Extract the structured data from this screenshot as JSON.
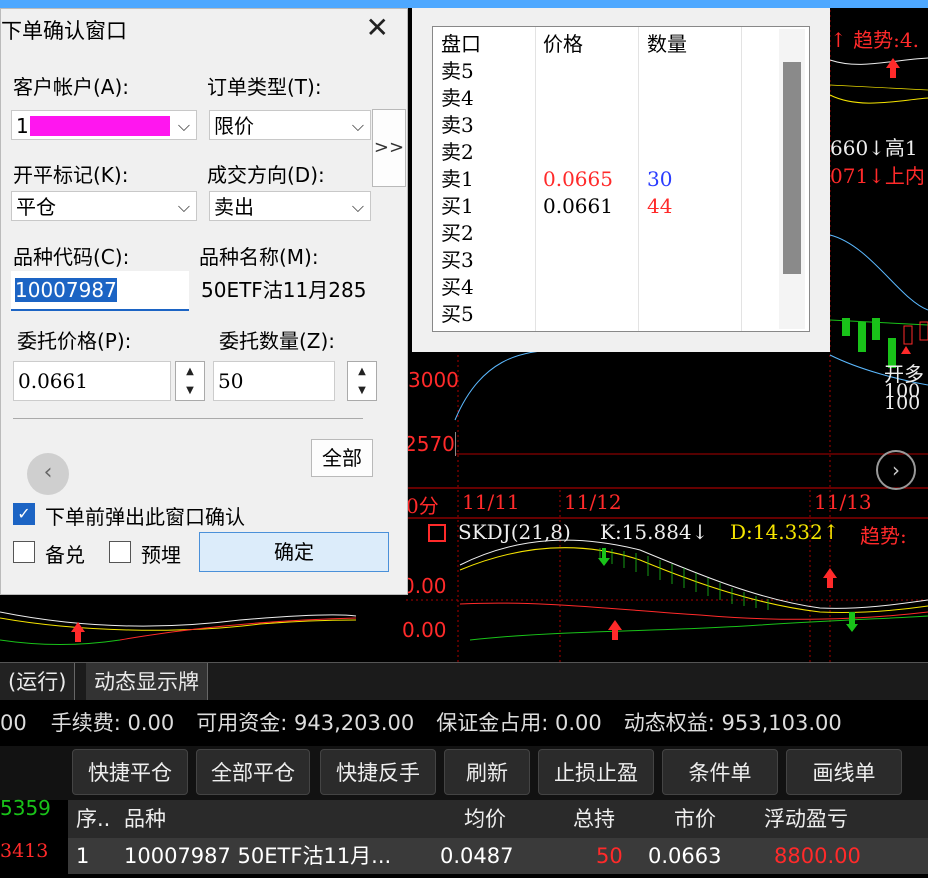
{
  "dialog": {
    "title": "下单确认窗口",
    "close": "✕",
    "account_label": "客户帐户(A):",
    "account_value": "1",
    "order_type_label": "订单类型(T):",
    "order_type_value": "限价",
    "open_close_label": "开平标记(K):",
    "open_close_value": "平仓",
    "direction_label": "成交方向(D):",
    "direction_value": "卖出",
    "code_label": "品种代码(C):",
    "code_value": "10007987",
    "name_label": "品种名称(M):",
    "name_value": "50ETF沽11月285",
    "price_label": "委托价格(P):",
    "price_value": "0.0661",
    "qty_label": "委托数量(Z):",
    "qty_value": "50",
    "all_button": "全部",
    "expand_button": ">>",
    "confirm_popup_label": "下单前弹出此窗口确认",
    "covered_label": "备兑",
    "preset_label": "预埋",
    "confirm_button": "确定"
  },
  "order_book": {
    "headers": [
      "盘口",
      "价格",
      "数量"
    ],
    "rows": [
      {
        "side": "卖5",
        "price": "",
        "qty": ""
      },
      {
        "side": "卖4",
        "price": "",
        "qty": ""
      },
      {
        "side": "卖3",
        "price": "",
        "qty": ""
      },
      {
        "side": "卖2",
        "price": "",
        "qty": ""
      },
      {
        "side": "卖1",
        "price": "0.0665",
        "qty": "30"
      },
      {
        "side": "买1",
        "price": "0.0661",
        "qty": "44"
      },
      {
        "side": "买2",
        "price": "",
        "qty": ""
      },
      {
        "side": "买3",
        "price": "",
        "qty": ""
      },
      {
        "side": "买4",
        "price": "",
        "qty": ""
      },
      {
        "side": "买5",
        "price": "",
        "qty": ""
      }
    ]
  },
  "chart": {
    "trend_top": "↑ 趋势:4.",
    "val_660": "660↓高1",
    "val_071": "071↓上内",
    "y_3000": "3000",
    "y_2570": "2570",
    "min_label": "0分",
    "dates": [
      "11/11",
      "11/12",
      "11/13"
    ],
    "indicator": "SKDJ(21,8)",
    "k_value": "K:15.884↓",
    "d_value": "D:14.332↑",
    "trend_bottom": "趋势:",
    "y_000a": "0.00",
    "y_000b": "0.00",
    "annot_1": "开多",
    "annot_2": "100",
    "annot_3": "100"
  },
  "tabs": [
    "(运行)",
    "动态显示牌"
  ],
  "status": {
    "lead": "00",
    "fee": "手续费: 0.00",
    "available": "可用资金: 943,203.00",
    "margin": "保证金占用: 0.00",
    "equity": "动态权益: 953,103.00"
  },
  "toolbar": [
    "快捷平仓",
    "全部平仓",
    "快捷反手",
    "刷新",
    "止损止盈",
    "条件单",
    "画线单"
  ],
  "left_prices": [
    "5359",
    "3413"
  ],
  "positions": {
    "headers": [
      "序..",
      "品种",
      "均价",
      "总持",
      "市价",
      "浮动盈亏",
      "「"
    ],
    "rows": [
      {
        "idx": "1",
        "name": "10007987 50ETF沽11月...",
        "avg": "0.0487",
        "hold": "50",
        "market": "0.0663",
        "pnl": "8800.00"
      }
    ]
  },
  "colors": {
    "red": "#ff2a2a",
    "green": "#19c219",
    "yellow": "#f5e400",
    "blue": "#2a3cff",
    "magenta": "#ff16ef"
  }
}
